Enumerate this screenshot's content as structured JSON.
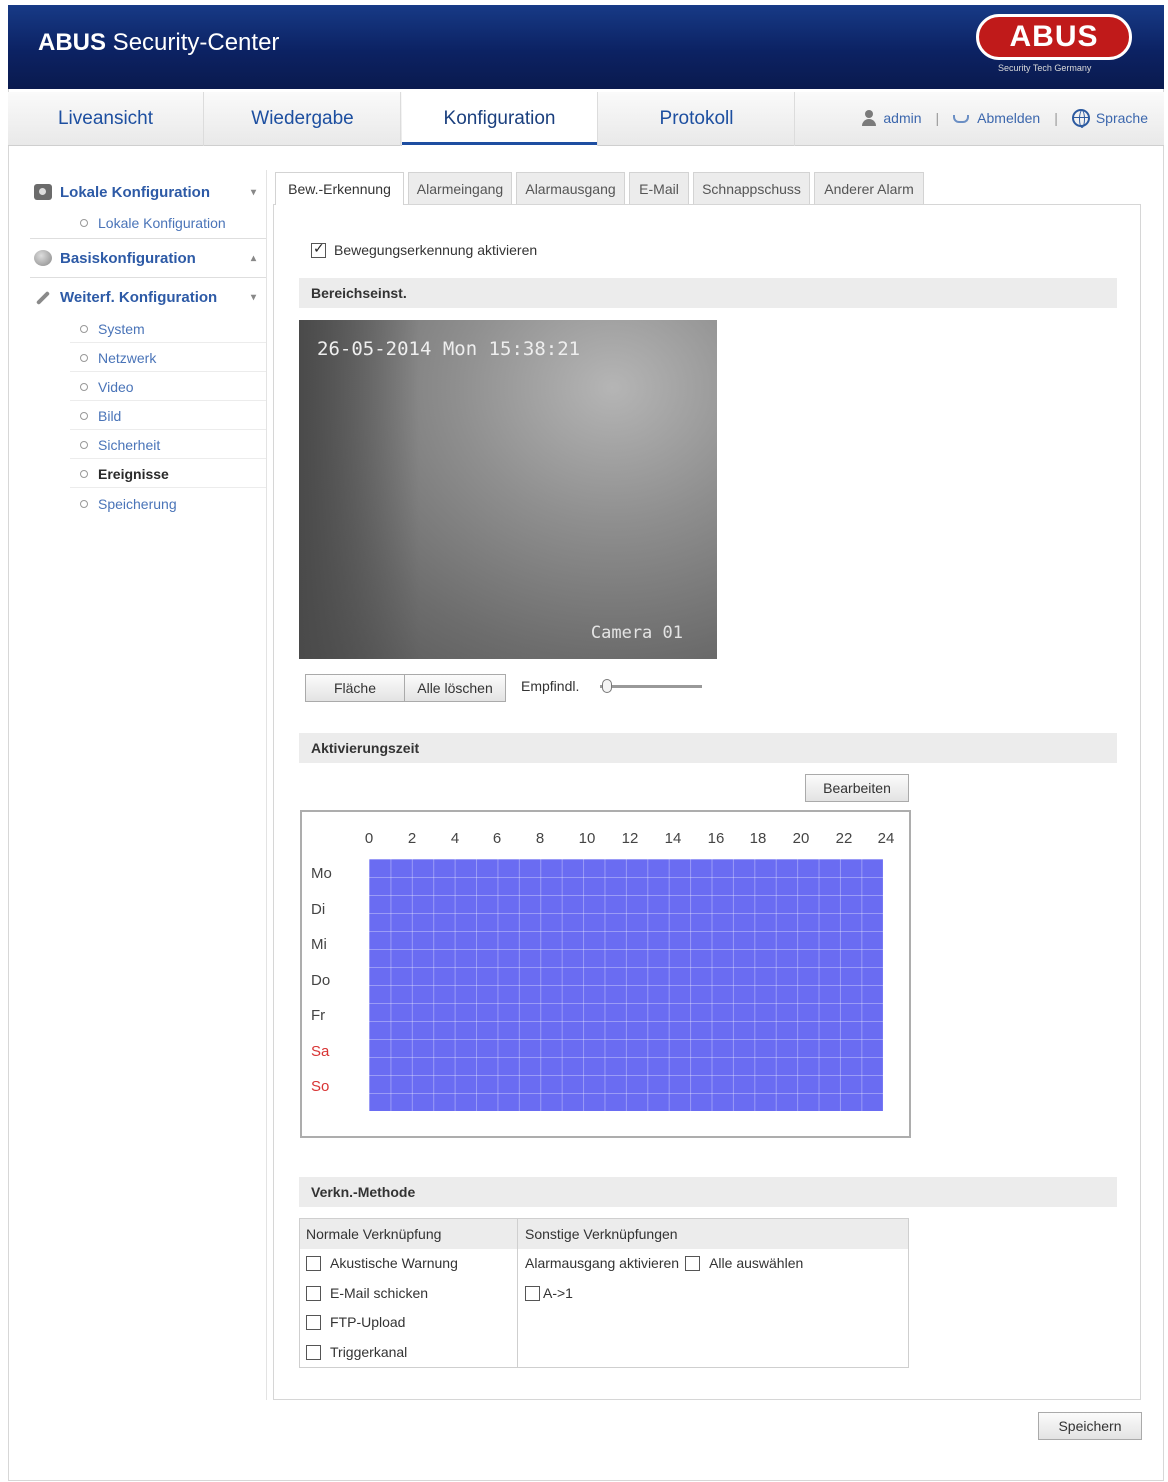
{
  "header": {
    "title_bold": "ABUS",
    "title_rest": " Security-Center",
    "logo_text": "ABUS",
    "logo_subtitle": "Security Tech Germany"
  },
  "nav": {
    "tabs": [
      "Liveansicht",
      "Wiedergabe",
      "Konfiguration",
      "Protokoll"
    ],
    "active": "Konfiguration",
    "user": "admin",
    "logout": "Abmelden",
    "language": "Sprache",
    "separator": "|"
  },
  "sidebar": {
    "sections": [
      {
        "label": "Lokale Konfiguration",
        "caret": "▾"
      },
      {
        "label": "Basiskonfiguration",
        "caret": "▴"
      },
      {
        "label": "Weiterf. Konfiguration",
        "caret": "▾"
      }
    ],
    "local_items": [
      "Lokale Konfiguration"
    ],
    "advanced_items": [
      "System",
      "Netzwerk",
      "Video",
      "Bild",
      "Sicherheit",
      "Ereignisse",
      "Speicherung"
    ],
    "selected": "Ereignisse"
  },
  "tabs": [
    "Bew.-Erkennung",
    "Alarmeingang",
    "Alarmausgang",
    "E-Mail",
    "Schnappschuss",
    "Anderer Alarm"
  ],
  "active_tab": "Bew.-Erkennung",
  "motion": {
    "enable_label": "Bewegungserkennung aktivieren",
    "enabled": true,
    "area_section": "Bereichseinst.",
    "video_timestamp": "26-05-2014 Mon 15:38:21",
    "video_camera": "Camera 01",
    "btn_area": "Fläche",
    "btn_clear": "Alle löschen",
    "sensitivity_label": "Empfindl.",
    "sensitivity": 0
  },
  "schedule": {
    "section": "Aktivierungszeit",
    "edit_button": "Bearbeiten",
    "hours": [
      "0",
      "2",
      "4",
      "6",
      "8",
      "10",
      "12",
      "14",
      "16",
      "18",
      "20",
      "22",
      "24"
    ],
    "days": [
      "Mo",
      "Di",
      "Mi",
      "Do",
      "Fr",
      "Sa",
      "So"
    ],
    "weekend_color": "#d83434",
    "active_color": "#6a6cf2"
  },
  "linkage": {
    "section": "Verkn.-Methode",
    "col_normal": "Normale Verknüpfung",
    "col_other": "Sonstige Verknüpfungen",
    "normal_items": [
      "Akustische Warnung",
      "E-Mail schicken",
      "FTP-Upload",
      "Triggerkanal"
    ],
    "alarm_out_label": "Alarmausgang aktivieren",
    "select_all": "Alle auswählen",
    "output": "A->1"
  },
  "save_button": "Speichern",
  "colors": {
    "header": "#0c2263",
    "accent": "#1e4ea1",
    "logo": "#c01a1a"
  }
}
